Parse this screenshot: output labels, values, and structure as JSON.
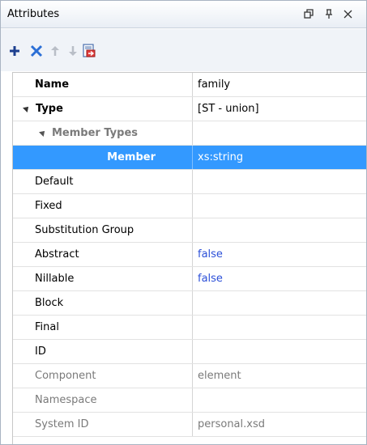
{
  "panel": {
    "title": "Attributes",
    "controls": [
      "restore-icon",
      "pin-icon",
      "close-icon"
    ]
  },
  "toolbar": {
    "tools": [
      "add-icon",
      "remove-icon",
      "move-up-icon",
      "move-down-icon",
      "go-to-definition-icon"
    ]
  },
  "rows": [
    {
      "name": "Name",
      "value": "family"
    },
    {
      "name": "Type",
      "value": "[ST - union]"
    },
    {
      "name": "Member Types",
      "value": ""
    },
    {
      "name": "Member",
      "value": "xs:string"
    },
    {
      "name": "Default",
      "value": ""
    },
    {
      "name": "Fixed",
      "value": ""
    },
    {
      "name": "Substitution Group",
      "value": ""
    },
    {
      "name": "Abstract",
      "value": "false"
    },
    {
      "name": "Nillable",
      "value": "false"
    },
    {
      "name": "Block",
      "value": ""
    },
    {
      "name": "Final",
      "value": ""
    },
    {
      "name": "ID",
      "value": ""
    },
    {
      "name": "Component",
      "value": "element"
    },
    {
      "name": "Namespace",
      "value": ""
    },
    {
      "name": "System ID",
      "value": "personal.xsd"
    }
  ],
  "colors": {
    "selection": "#3399ff",
    "default_value_text": "#2b4fd8",
    "readonly_text": "#7a7a7a"
  }
}
